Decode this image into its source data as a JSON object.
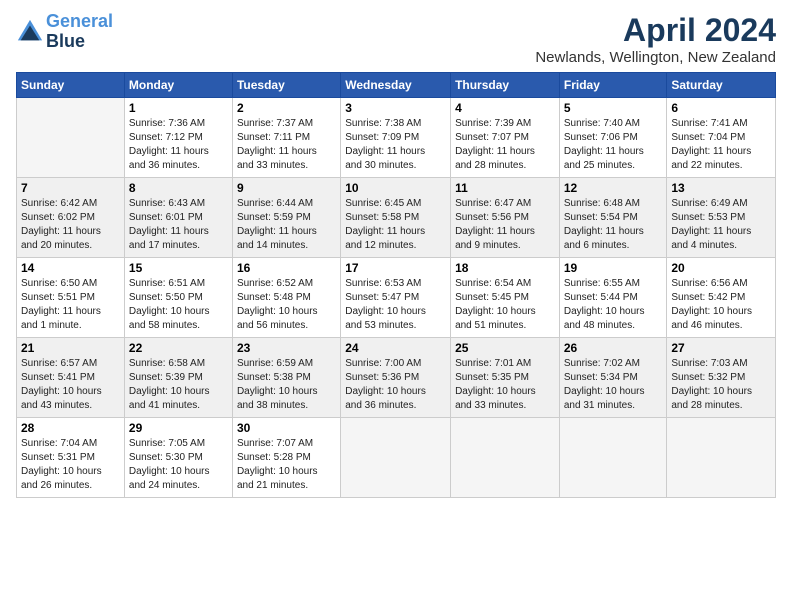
{
  "header": {
    "logo_line1": "General",
    "logo_line2": "Blue",
    "month_title": "April 2024",
    "location": "Newlands, Wellington, New Zealand"
  },
  "weekdays": [
    "Sunday",
    "Monday",
    "Tuesday",
    "Wednesday",
    "Thursday",
    "Friday",
    "Saturday"
  ],
  "weeks": [
    [
      {
        "num": "",
        "info": ""
      },
      {
        "num": "1",
        "info": "Sunrise: 7:36 AM\nSunset: 7:12 PM\nDaylight: 11 hours\nand 36 minutes."
      },
      {
        "num": "2",
        "info": "Sunrise: 7:37 AM\nSunset: 7:11 PM\nDaylight: 11 hours\nand 33 minutes."
      },
      {
        "num": "3",
        "info": "Sunrise: 7:38 AM\nSunset: 7:09 PM\nDaylight: 11 hours\nand 30 minutes."
      },
      {
        "num": "4",
        "info": "Sunrise: 7:39 AM\nSunset: 7:07 PM\nDaylight: 11 hours\nand 28 minutes."
      },
      {
        "num": "5",
        "info": "Sunrise: 7:40 AM\nSunset: 7:06 PM\nDaylight: 11 hours\nand 25 minutes."
      },
      {
        "num": "6",
        "info": "Sunrise: 7:41 AM\nSunset: 7:04 PM\nDaylight: 11 hours\nand 22 minutes."
      }
    ],
    [
      {
        "num": "7",
        "info": "Sunrise: 6:42 AM\nSunset: 6:02 PM\nDaylight: 11 hours\nand 20 minutes."
      },
      {
        "num": "8",
        "info": "Sunrise: 6:43 AM\nSunset: 6:01 PM\nDaylight: 11 hours\nand 17 minutes."
      },
      {
        "num": "9",
        "info": "Sunrise: 6:44 AM\nSunset: 5:59 PM\nDaylight: 11 hours\nand 14 minutes."
      },
      {
        "num": "10",
        "info": "Sunrise: 6:45 AM\nSunset: 5:58 PM\nDaylight: 11 hours\nand 12 minutes."
      },
      {
        "num": "11",
        "info": "Sunrise: 6:47 AM\nSunset: 5:56 PM\nDaylight: 11 hours\nand 9 minutes."
      },
      {
        "num": "12",
        "info": "Sunrise: 6:48 AM\nSunset: 5:54 PM\nDaylight: 11 hours\nand 6 minutes."
      },
      {
        "num": "13",
        "info": "Sunrise: 6:49 AM\nSunset: 5:53 PM\nDaylight: 11 hours\nand 4 minutes."
      }
    ],
    [
      {
        "num": "14",
        "info": "Sunrise: 6:50 AM\nSunset: 5:51 PM\nDaylight: 11 hours\nand 1 minute."
      },
      {
        "num": "15",
        "info": "Sunrise: 6:51 AM\nSunset: 5:50 PM\nDaylight: 10 hours\nand 58 minutes."
      },
      {
        "num": "16",
        "info": "Sunrise: 6:52 AM\nSunset: 5:48 PM\nDaylight: 10 hours\nand 56 minutes."
      },
      {
        "num": "17",
        "info": "Sunrise: 6:53 AM\nSunset: 5:47 PM\nDaylight: 10 hours\nand 53 minutes."
      },
      {
        "num": "18",
        "info": "Sunrise: 6:54 AM\nSunset: 5:45 PM\nDaylight: 10 hours\nand 51 minutes."
      },
      {
        "num": "19",
        "info": "Sunrise: 6:55 AM\nSunset: 5:44 PM\nDaylight: 10 hours\nand 48 minutes."
      },
      {
        "num": "20",
        "info": "Sunrise: 6:56 AM\nSunset: 5:42 PM\nDaylight: 10 hours\nand 46 minutes."
      }
    ],
    [
      {
        "num": "21",
        "info": "Sunrise: 6:57 AM\nSunset: 5:41 PM\nDaylight: 10 hours\nand 43 minutes."
      },
      {
        "num": "22",
        "info": "Sunrise: 6:58 AM\nSunset: 5:39 PM\nDaylight: 10 hours\nand 41 minutes."
      },
      {
        "num": "23",
        "info": "Sunrise: 6:59 AM\nSunset: 5:38 PM\nDaylight: 10 hours\nand 38 minutes."
      },
      {
        "num": "24",
        "info": "Sunrise: 7:00 AM\nSunset: 5:36 PM\nDaylight: 10 hours\nand 36 minutes."
      },
      {
        "num": "25",
        "info": "Sunrise: 7:01 AM\nSunset: 5:35 PM\nDaylight: 10 hours\nand 33 minutes."
      },
      {
        "num": "26",
        "info": "Sunrise: 7:02 AM\nSunset: 5:34 PM\nDaylight: 10 hours\nand 31 minutes."
      },
      {
        "num": "27",
        "info": "Sunrise: 7:03 AM\nSunset: 5:32 PM\nDaylight: 10 hours\nand 28 minutes."
      }
    ],
    [
      {
        "num": "28",
        "info": "Sunrise: 7:04 AM\nSunset: 5:31 PM\nDaylight: 10 hours\nand 26 minutes."
      },
      {
        "num": "29",
        "info": "Sunrise: 7:05 AM\nSunset: 5:30 PM\nDaylight: 10 hours\nand 24 minutes."
      },
      {
        "num": "30",
        "info": "Sunrise: 7:07 AM\nSunset: 5:28 PM\nDaylight: 10 hours\nand 21 minutes."
      },
      {
        "num": "",
        "info": ""
      },
      {
        "num": "",
        "info": ""
      },
      {
        "num": "",
        "info": ""
      },
      {
        "num": "",
        "info": ""
      }
    ]
  ]
}
